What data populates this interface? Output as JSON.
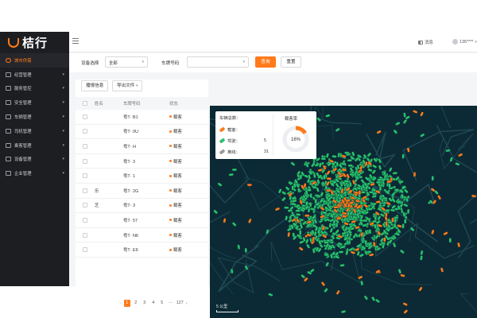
{
  "brand": {
    "name": "桔行",
    "accent": "#ff7a1a"
  },
  "sidebar": {
    "items": [
      {
        "label": "城市供需",
        "icon": "location-icon",
        "active": true
      },
      {
        "label": "经营管理",
        "icon": "chart-icon"
      },
      {
        "label": "服务管控",
        "icon": "service-icon"
      },
      {
        "label": "安全管理",
        "icon": "shield-icon"
      },
      {
        "label": "车辆管理",
        "icon": "car-icon"
      },
      {
        "label": "司机管理",
        "icon": "driver-icon"
      },
      {
        "label": "乘客管理",
        "icon": "passenger-icon"
      },
      {
        "label": "设备管理",
        "icon": "device-icon"
      },
      {
        "label": "企业管理",
        "icon": "enterprise-icon"
      }
    ]
  },
  "header": {
    "messages_label": "消息",
    "user_label": "135****"
  },
  "filters": {
    "device_label": "设备选择",
    "device_value": "全部",
    "plate_label": "车牌号码",
    "plate_value": "",
    "query_label": "查询",
    "reset_label": "重置"
  },
  "panel": {
    "report_label": "播报信息",
    "export_label": "导出文件",
    "columns": [
      "姓名",
      "车牌号码",
      "状态"
    ],
    "rows": [
      {
        "name": "",
        "plate": "粤T·    B1",
        "status": "载客"
      },
      {
        "name": "",
        "plate": "粤T·    0U",
        "status": "载客"
      },
      {
        "name": "",
        "plate": "粤T·    H",
        "status": "载客"
      },
      {
        "name": "",
        "plate": "粤T·    3",
        "status": "载客"
      },
      {
        "name": "",
        "plate": "粤T·    1",
        "status": "载客"
      },
      {
        "name": "乐",
        "plate": "粤T·    2G",
        "status": "载客"
      },
      {
        "name": "芝",
        "plate": "粤T·    3",
        "status": "载客"
      },
      {
        "name": "",
        "plate": "粤T·    57",
        "status": "载客"
      },
      {
        "name": "",
        "plate": "粤T·    N6",
        "status": "载客"
      },
      {
        "name": "",
        "plate": "粤T·    E9",
        "status": "载客"
      }
    ],
    "pages": [
      "1",
      "2",
      "3",
      "4",
      "5",
      "···",
      "127"
    ],
    "current_page": "1"
  },
  "stats": {
    "total_label": "车辆总数：",
    "total_value": "",
    "items": [
      {
        "label": "载客：",
        "value": "",
        "color": "#ff7a1a"
      },
      {
        "label": "驾驶：",
        "value": "5",
        "color": "#27c26c"
      },
      {
        "label": "离线：",
        "value": "31",
        "color": "#9a9a9a"
      }
    ],
    "occupancy_label": "载客率",
    "occupancy_pct": "16%",
    "occupancy_fraction": 0.16
  },
  "map": {
    "scale_label": "5 公里",
    "road_color": "#1f4b56",
    "bg_color": "#0c2a35"
  }
}
